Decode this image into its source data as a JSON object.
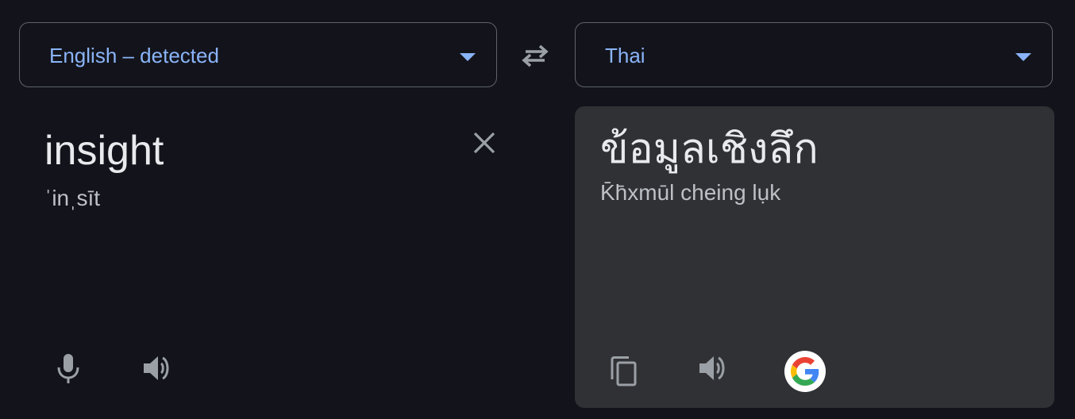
{
  "source": {
    "language_label": "English – detected",
    "text": "insight",
    "phonetic": "ˈinˌsīt"
  },
  "target": {
    "language_label": "Thai",
    "text": "ข้อมูลเชิงลึก",
    "transliteration": "K̄h̄xmūl cheing lụk"
  },
  "icons": {
    "dropdown": "caret-down-icon",
    "swap": "swap-arrows-icon",
    "clear": "close-icon",
    "mic": "microphone-icon",
    "listen": "speaker-icon",
    "copy": "copy-icon",
    "google": "google-logo-icon"
  },
  "colors": {
    "background": "#13141b",
    "accent": "#8ab4f8",
    "panel": "#303134",
    "text": "#e8eaed",
    "muted": "#bdc1c6",
    "icon": "#9aa0a6"
  }
}
